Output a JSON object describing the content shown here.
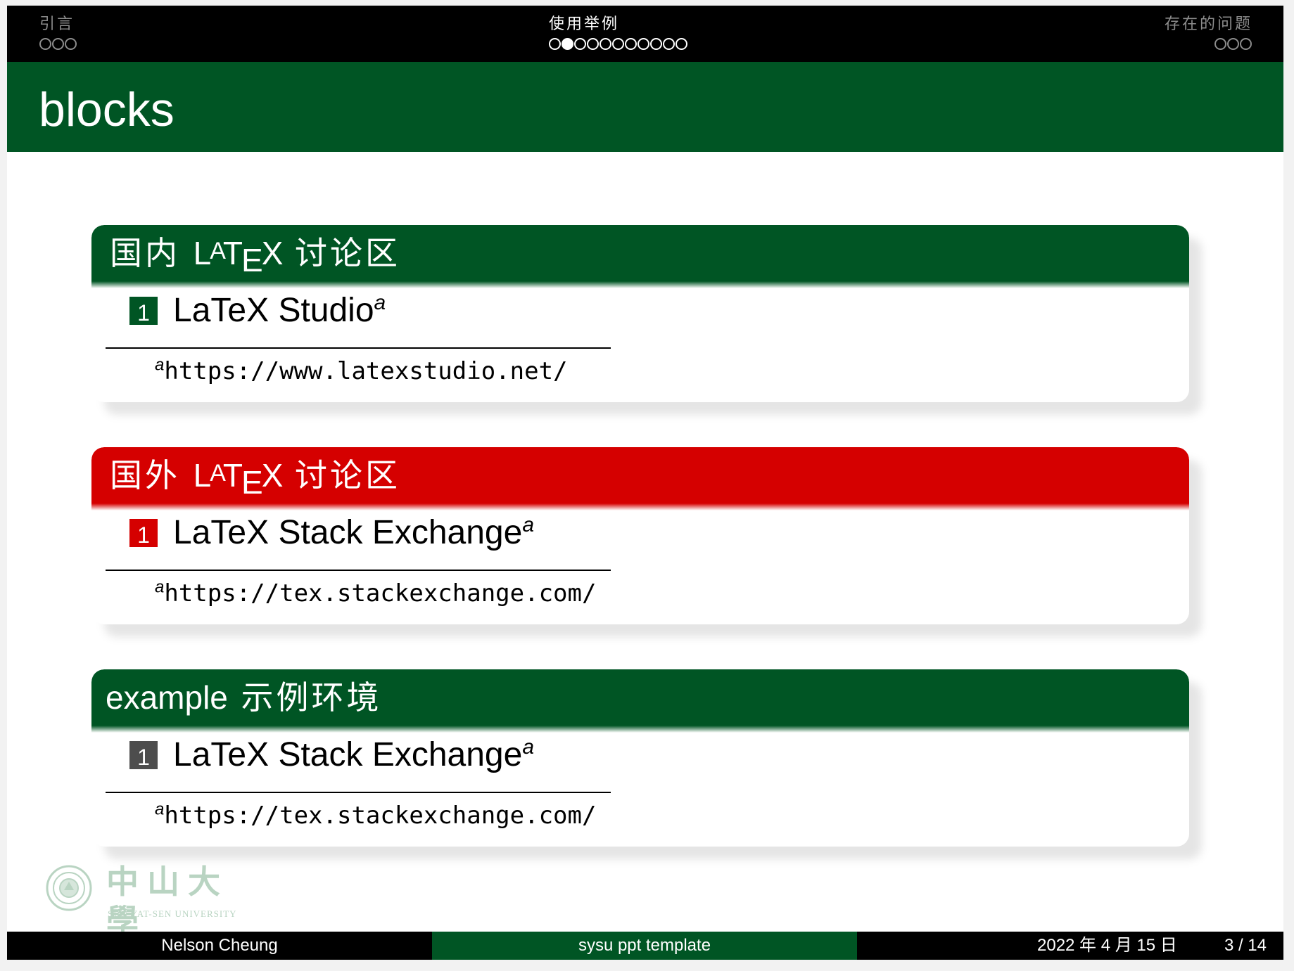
{
  "navigation": {
    "sections": [
      {
        "label": "引言",
        "dots": 3,
        "current_dot": -1,
        "active": false
      },
      {
        "label": "使用举例",
        "dots": 11,
        "current_dot": 1,
        "active": true
      },
      {
        "label": "存在的问题",
        "dots": 3,
        "current_dot": -1,
        "active": false
      }
    ]
  },
  "frame": {
    "title": "blocks"
  },
  "blocks": [
    {
      "title_pre": "国内",
      "title_latex": "LATEX",
      "title_post": "讨论区",
      "style": "block",
      "color": "#005524",
      "item_number": "1",
      "item_text": "LaTeX Studio",
      "footnote_mark": "a",
      "footnote": "https://www.latexstudio.net/"
    },
    {
      "title_pre": "国外",
      "title_latex": "LATEX",
      "title_post": "讨论区",
      "style": "alertblock",
      "color": "#d50000",
      "item_number": "1",
      "item_text": "LaTeX Stack Exchange",
      "footnote_mark": "a",
      "footnote": "https://tex.stackexchange.com/"
    },
    {
      "title_en": "example",
      "title_cn": "示例环境",
      "style": "exampleblock",
      "color": "#005524",
      "item_number": "1",
      "item_text": "LaTeX Stack Exchange",
      "footnote_mark": "a",
      "footnote": "https://tex.stackexchange.com/"
    }
  ],
  "logo": {
    "name_cn": "中山大學",
    "name_en": "SUN YAT-SEN UNIVERSITY"
  },
  "footer": {
    "author": "Nelson Cheung",
    "title": "sysu ppt template",
    "date": "2022 年 4 月 15 日",
    "page": "3 / 14"
  },
  "colors": {
    "accent_green": "#005524",
    "alert_red": "#d50000",
    "bar_black": "#000000",
    "example_badge": "#4d4d4d",
    "logo_tint": "#b9d4c2"
  }
}
